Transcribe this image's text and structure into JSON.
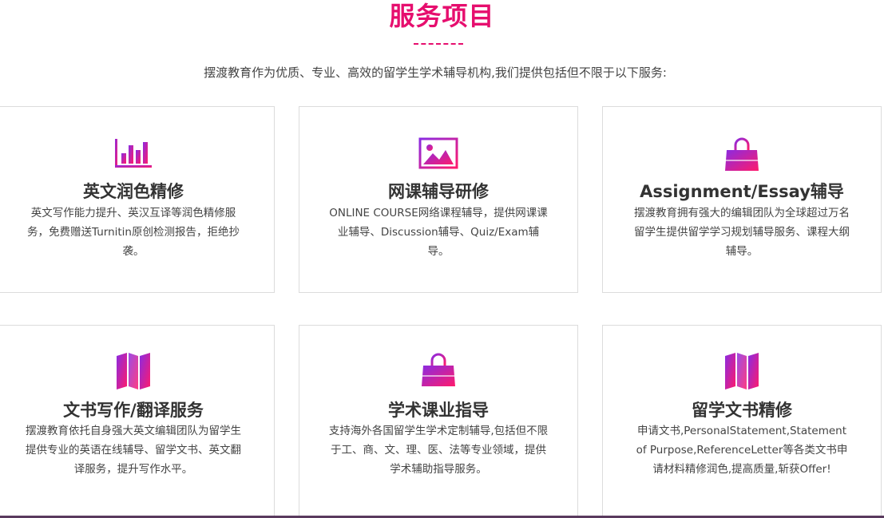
{
  "colors": {
    "accent": "#e60e6e",
    "gradient_start": "#8a2be2",
    "gradient_end": "#ff1a6c",
    "text_main": "#333333",
    "text_body": "#444444",
    "border": "#dcdcdc"
  },
  "section": {
    "title": "服务项目",
    "intro": "摆渡教育作为优质、专业、高效的留学生学术辅导机构,我们提供包括但不限于以下服务:"
  },
  "services": [
    {
      "icon": "bar-chart-icon",
      "title": "英文润色精修",
      "desc": "英文写作能力提升、英汉互译等润色精修服务，免费赠送Turnitin原创检测报告，拒绝抄袭。"
    },
    {
      "icon": "image-icon",
      "title": "网课辅导研修",
      "desc": "ONLINE COURSE网络课程辅导，提供网课课业辅导、Discussion辅导、Quiz/Exam辅导。"
    },
    {
      "icon": "shopping-bag-icon",
      "title": "Assignment/Essay辅导",
      "desc": "摆渡教育拥有强大的编辑团队为全球超过万名留学生提供留学学习规划辅导服务、课程大纲辅导。"
    },
    {
      "icon": "map-icon",
      "title": "文书写作/翻译服务",
      "desc": "摆渡教育依托自身强大英文编辑团队为留学生提供专业的英语在线辅导、留学文书、英文翻译服务，提升写作水平。"
    },
    {
      "icon": "shopping-bag-icon",
      "title": "学术课业指导",
      "desc": "支持海外各国留学生学术定制辅导,包括但不限于工、商、文、理、医、法等专业领域，提供学术辅助指导服务。"
    },
    {
      "icon": "map-icon",
      "title": "留学文书精修",
      "desc": "申请文书,PersonalStatement,Statement of Purpose,ReferenceLetter等各类文书申请材料精修润色,提高质量,斩获Offer!"
    }
  ]
}
